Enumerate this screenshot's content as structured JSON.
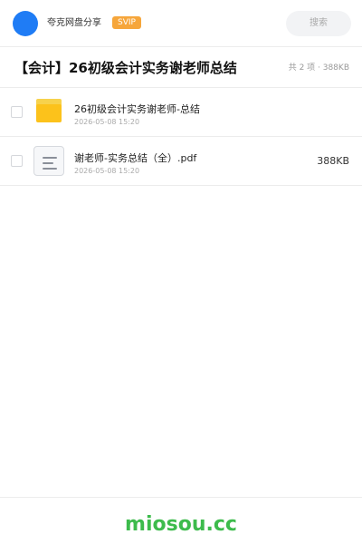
{
  "header": {
    "username": "夸克网盘分享",
    "badge": "SVIP",
    "search_label": "搜索",
    "accent_color": "#1f7cf5",
    "badge_color": "#f6a63b"
  },
  "share": {
    "title": "【会计】26初级会计实务谢老师总结",
    "summary": "共 2 项 · 388KB"
  },
  "files": [
    {
      "icon": "folder-icon",
      "name": "26初级会计实务谢老师-总结",
      "date": "2026-05-08 15:20",
      "size": ""
    },
    {
      "icon": "document-icon",
      "name": "谢老师-实务总结（全）.pdf",
      "date": "2026-05-08 15:20",
      "size": "388KB"
    }
  ],
  "footer": {
    "watermark": "miosou.cc",
    "watermark_color": "#3dbb4c"
  }
}
